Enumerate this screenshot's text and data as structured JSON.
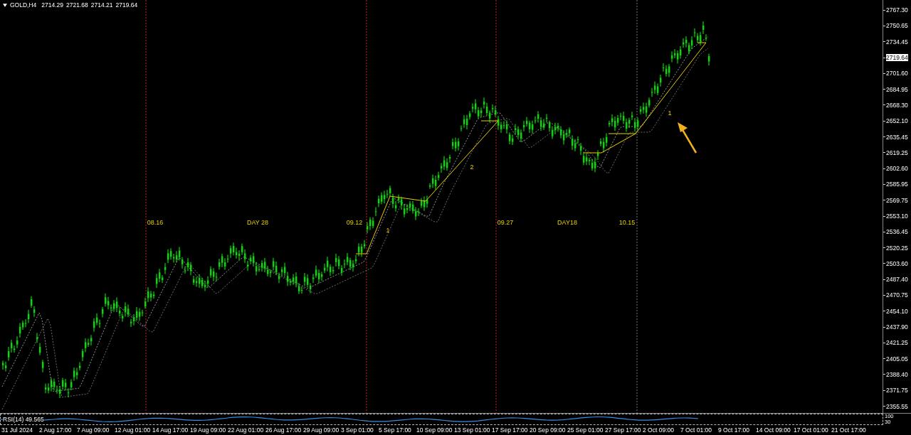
{
  "header": {
    "symbol": "GOLD,H4",
    "quotes": [
      "2714.29",
      "2721.68",
      "2714.21",
      "2719.64"
    ]
  },
  "annotations": [
    {
      "text": "08.16"
    },
    {
      "text": "DAY 28"
    },
    {
      "text": "09.12"
    },
    {
      "text": "1"
    },
    {
      "text": "2"
    },
    {
      "text": "09.27"
    },
    {
      "text": "DAY18"
    },
    {
      "text": "10.15"
    },
    {
      "text": "1"
    }
  ],
  "price_axis": [
    {
      "label": "2767.30",
      "current": false
    },
    {
      "label": "2750.65",
      "current": false
    },
    {
      "label": "2734.45",
      "current": false
    },
    {
      "label": "2719.64",
      "current": true
    },
    {
      "label": "2701.60",
      "current": false
    },
    {
      "label": "2684.95",
      "current": false
    },
    {
      "label": "2668.30",
      "current": false
    },
    {
      "label": "2652.10",
      "current": false
    },
    {
      "label": "2635.45",
      "current": false
    },
    {
      "label": "2619.25",
      "current": false
    },
    {
      "label": "2602.60",
      "current": false
    },
    {
      "label": "2585.95",
      "current": false
    },
    {
      "label": "2569.75",
      "current": false
    },
    {
      "label": "2553.10",
      "current": false
    },
    {
      "label": "2536.45",
      "current": false
    },
    {
      "label": "2520.25",
      "current": false
    },
    {
      "label": "2503.60",
      "current": false
    },
    {
      "label": "2487.40",
      "current": false
    },
    {
      "label": "2470.75",
      "current": false
    },
    {
      "label": "2454.10",
      "current": false
    },
    {
      "label": "2437.90",
      "current": false
    },
    {
      "label": "2421.25",
      "current": false
    },
    {
      "label": "2405.05",
      "current": false
    },
    {
      "label": "2388.40",
      "current": false
    },
    {
      "label": "2371.75",
      "current": false
    },
    {
      "label": "2355.55",
      "current": false
    }
  ],
  "indicator": {
    "label": "RSI(14) 49.565",
    "levels": [
      "100",
      "30"
    ]
  },
  "time_axis": [
    "31 Jul 2024",
    "2 Aug 17:00",
    "7 Aug 09:00",
    "12 Aug 01:00",
    "14 Aug 17:00",
    "19 Aug 09:00",
    "22 Aug 01:00",
    "26 Aug 17:00",
    "29 Aug 09:00",
    "3 Sep 01:00",
    "5 Sep 17:00",
    "10 Sep 09:00",
    "13 Sep 01:00",
    "17 Sep 17:00",
    "20 Sep 09:00",
    "25 Sep 01:00",
    "27 Sep 17:00",
    "2 Oct 09:00",
    "7 Oct 01:00",
    "9 Oct 17:00",
    "14 Oct 09:00",
    "17 Oct 01:00",
    "21 Oct 17:00"
  ]
}
